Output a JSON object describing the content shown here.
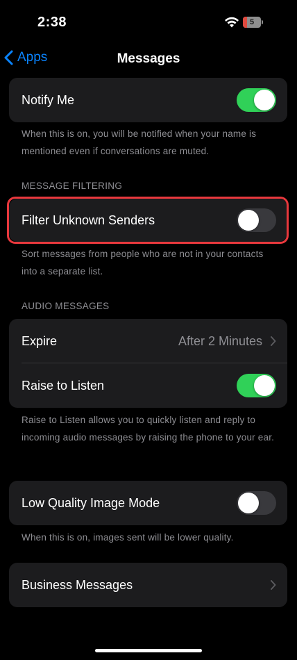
{
  "status_bar": {
    "time": "2:38",
    "battery_level": "5"
  },
  "nav": {
    "back_label": "Apps",
    "title": "Messages"
  },
  "notify_me": {
    "label": "Notify Me",
    "on": true,
    "footer": "When this is on, you will be notified when your name is mentioned even if conversations are muted."
  },
  "message_filtering": {
    "header": "MESSAGE FILTERING",
    "filter_unknown_label": "Filter Unknown Senders",
    "filter_unknown_on": false,
    "footer": "Sort messages from people who are not in your contacts into a separate list."
  },
  "audio_messages": {
    "header": "AUDIO MESSAGES",
    "expire_label": "Expire",
    "expire_value": "After 2 Minutes",
    "raise_label": "Raise to Listen",
    "raise_on": true,
    "footer": "Raise to Listen allows you to quickly listen and reply to incoming audio messages by raising the phone to your ear."
  },
  "low_quality": {
    "label": "Low Quality Image Mode",
    "on": false,
    "footer": "When this is on, images sent will be lower quality."
  },
  "business": {
    "label": "Business Messages"
  },
  "colors": {
    "accent": "#0a84ff",
    "toggle_on": "#30d158",
    "highlight": "#e8383d"
  }
}
